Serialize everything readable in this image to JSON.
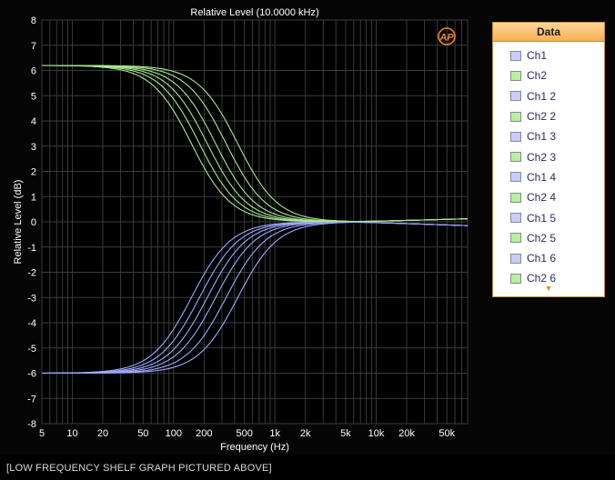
{
  "chart_data": {
    "type": "line",
    "title": "Relative Level (10.0000 kHz)",
    "xlabel": "Frequency (Hz)",
    "ylabel": "Relative Level (dB)",
    "xscale": "log",
    "xlim": [
      5,
      80000
    ],
    "ylim": [
      -8,
      8
    ],
    "grid": true,
    "x_ticks": [
      5,
      10,
      20,
      50,
      100,
      200,
      500,
      1000,
      2000,
      5000,
      10000,
      20000,
      50000
    ],
    "x_tick_labels": [
      "5",
      "10",
      "20",
      "50",
      "100",
      "200",
      "500",
      "1k",
      "2k",
      "5k",
      "10k",
      "20k",
      "50k"
    ],
    "y_ticks": [
      8,
      7,
      6,
      5,
      4,
      3,
      2,
      1,
      0,
      -1,
      -2,
      -3,
      -4,
      -5,
      -6,
      -7,
      -8
    ],
    "y_tick_labels": [
      "8",
      "7",
      "6",
      "5",
      "4",
      "3",
      "2",
      "1",
      "0",
      "-1",
      "-2",
      "-3",
      "-4",
      "-5",
      "-6",
      "-7",
      "-8"
    ],
    "legend_placement": "right",
    "series": [
      {
        "name": "Ch1",
        "color": "#a0a8ff",
        "gain_db": -6.0,
        "corner_hz": 150
      },
      {
        "name": "Ch2",
        "color": "#a8e890",
        "gain_db": 6.2,
        "corner_hz": 150
      },
      {
        "name": "Ch1 2",
        "color": "#a0a8ff",
        "gain_db": -6.0,
        "corner_hz": 180
      },
      {
        "name": "Ch2 2",
        "color": "#a8e890",
        "gain_db": 6.2,
        "corner_hz": 180
      },
      {
        "name": "Ch1 3",
        "color": "#a0a8ff",
        "gain_db": -6.0,
        "corner_hz": 215
      },
      {
        "name": "Ch2 3",
        "color": "#a8e890",
        "gain_db": 6.2,
        "corner_hz": 215
      },
      {
        "name": "Ch1 4",
        "color": "#a0a8ff",
        "gain_db": -6.0,
        "corner_hz": 260
      },
      {
        "name": "Ch2 4",
        "color": "#a8e890",
        "gain_db": 6.2,
        "corner_hz": 260
      },
      {
        "name": "Ch1 5",
        "color": "#a0a8ff",
        "gain_db": -6.0,
        "corner_hz": 330
      },
      {
        "name": "Ch2 5",
        "color": "#a8e890",
        "gain_db": 6.2,
        "corner_hz": 330
      },
      {
        "name": "Ch1 6",
        "color": "#a0a8ff",
        "gain_db": -6.0,
        "corner_hz": 430
      },
      {
        "name": "Ch2 6",
        "color": "#a8e890",
        "gain_db": 6.2,
        "corner_hz": 430
      }
    ]
  },
  "legend": {
    "header": "Data",
    "items": [
      {
        "label": "Ch1",
        "color": "#c8ccff"
      },
      {
        "label": "Ch2",
        "color": "#b6f0a0"
      },
      {
        "label": "Ch1 2",
        "color": "#c8ccff"
      },
      {
        "label": "Ch2 2",
        "color": "#b6f0a0"
      },
      {
        "label": "Ch1 3",
        "color": "#c8ccff"
      },
      {
        "label": "Ch2 3",
        "color": "#b6f0a0"
      },
      {
        "label": "Ch1 4",
        "color": "#c8ccff"
      },
      {
        "label": "Ch2 4",
        "color": "#b6f0a0"
      },
      {
        "label": "Ch1 5",
        "color": "#c8ccff"
      },
      {
        "label": "Ch2 5",
        "color": "#b6f0a0"
      },
      {
        "label": "Ch1 6",
        "color": "#c8ccff"
      },
      {
        "label": "Ch2 6",
        "color": "#b6f0a0"
      }
    ],
    "more_icon": "triangle-down-icon"
  },
  "logo_text": "AP",
  "caption": "[LOW FREQUENCY SHELF GRAPH PICTURED ABOVE]"
}
